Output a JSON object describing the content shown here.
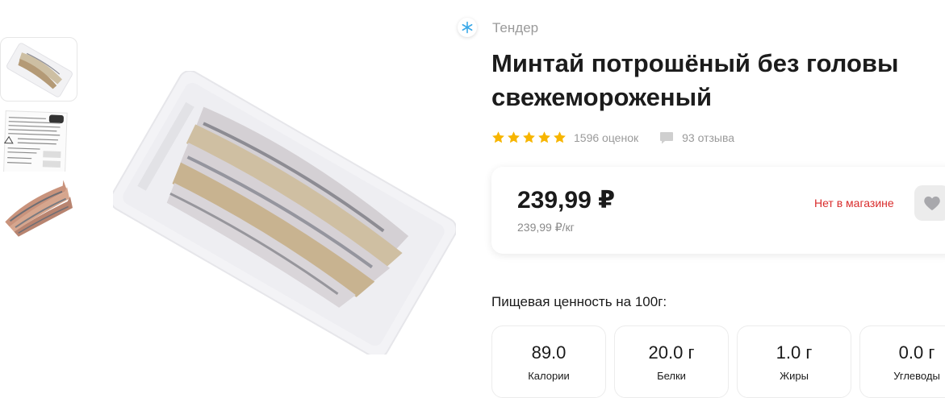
{
  "brand": {
    "name": "Тендер",
    "badge_icon": "snowflake-icon",
    "badge_color": "#3aa8e8"
  },
  "product": {
    "title": "Минтай потрошёный без головы свежемороженый"
  },
  "rating": {
    "stars": 5,
    "star_color": "#f7b500",
    "ratings_count": "1596 оценок",
    "reviews_count": "93 отзыва"
  },
  "price": {
    "current": "239,99 ₽",
    "per_kg": "239,99 ₽/кг",
    "availability": "Нет в магазине",
    "availability_color": "#d92c2c"
  },
  "nutrition": {
    "title": "Пищевая ценность на 100г:",
    "items": [
      {
        "value": "89.0",
        "label": "Калории"
      },
      {
        "value": "20.0 г",
        "label": "Белки"
      },
      {
        "value": "1.0 г",
        "label": "Жиры"
      },
      {
        "value": "0.0 г",
        "label": "Углеводы"
      }
    ]
  },
  "gallery": {
    "thumbnails": [
      "fish-package-front",
      "package-label",
      "fish-unpacked"
    ],
    "selected_index": 0
  }
}
